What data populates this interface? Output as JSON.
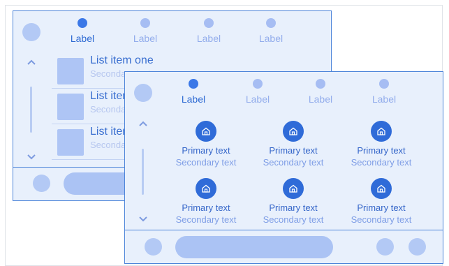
{
  "back_window": {
    "tabs": [
      {
        "label": "Label",
        "active": true
      },
      {
        "label": "Label",
        "active": false
      },
      {
        "label": "Label",
        "active": false
      },
      {
        "label": "Label",
        "active": false
      }
    ],
    "list_items": [
      {
        "primary": "List item one",
        "secondary": "Secondary text"
      },
      {
        "primary": "List item two",
        "secondary": "Secondary text"
      },
      {
        "primary": "List item three",
        "secondary": "Secondary text"
      }
    ]
  },
  "front_window": {
    "tabs": [
      {
        "label": "Label",
        "active": true
      },
      {
        "label": "Label",
        "active": false
      },
      {
        "label": "Label",
        "active": false
      },
      {
        "label": "Label",
        "active": false
      }
    ],
    "grid_items": [
      {
        "primary": "Primary text",
        "secondary": "Secondary text",
        "icon": "home-icon"
      },
      {
        "primary": "Primary text",
        "secondary": "Secondary text",
        "icon": "home-icon"
      },
      {
        "primary": "Primary text",
        "secondary": "Secondary text",
        "icon": "home-icon"
      },
      {
        "primary": "Primary text",
        "secondary": "Secondary text",
        "icon": "home-icon"
      },
      {
        "primary": "Primary text",
        "secondary": "Secondary text",
        "icon": "home-icon"
      },
      {
        "primary": "Primary text",
        "secondary": "Secondary text",
        "icon": "home-icon"
      }
    ]
  },
  "colors": {
    "accent": "#3b78e7",
    "surface": "#e8f0fc",
    "border": "#4c84d9",
    "placeholder": "#abc3f4"
  }
}
